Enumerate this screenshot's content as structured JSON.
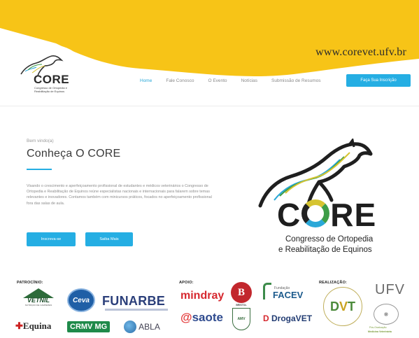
{
  "header": {
    "site_url": "www.corevet.ufv.br",
    "logo_text": "CORE",
    "logo_subtitle": "Congresso de Ortopedia e Reabilitação de Equinos",
    "nav": [
      {
        "label": "Home",
        "active": true
      },
      {
        "label": "Fale Conosco",
        "active": false
      },
      {
        "label": "O Evento",
        "active": false
      },
      {
        "label": "Notícias",
        "active": false
      },
      {
        "label": "Submissão de Resumos",
        "active": false
      }
    ],
    "cta_label": "Faça Sua Inscrição"
  },
  "hero": {
    "welcome": "Bem vindo(a)",
    "title": "Conheça O CORE",
    "description": "Visando o crescimento e aperfeiçoamento profissional de estudantes e médicos veterinários o Congresso de Ortopedia e Reabilitação de Equinos reúne especialistas nacionais e internacionais para falarem sobre temas relevantes e inovadores. Contamos também com minicursos práticos, focados no aperfeiçoamento profissional fora das salas de aula.",
    "button_primary": "Inscreva-se",
    "button_secondary": "Saiba Mais"
  },
  "brand": {
    "name": "CORE",
    "subtitle_line1": "Congresso de Ortopedia",
    "subtitle_line2": "e Reabilitação de Equinos"
  },
  "sponsors": {
    "patrocinio_label": "PATROCÍNIO:",
    "apoio_label": "APOIO:",
    "realizacao_label": "REALIZAÇÃO:",
    "patrocinio": [
      "VETNIL",
      "Ceva",
      "FUNARBE",
      "Equina",
      "CRMV MG",
      "ABLA"
    ],
    "apoio": [
      "mindray",
      "BRISTOL",
      "Fundação FACEV",
      "esaote",
      "AMV",
      "DrogaVET"
    ],
    "realizacao": [
      "DVT",
      "UFV"
    ],
    "vetnil_tag": "NUTRIÇÃO DE CAMPEÕES",
    "bristol_tag": "BRISTOL",
    "facev_tag": "Fundação",
    "ufv_program_1": "Pós-Graduação",
    "ufv_program_2": "Medicina Veterinária"
  },
  "colors": {
    "header_yellow": "#f7c417",
    "accent_blue": "#25aee3"
  }
}
